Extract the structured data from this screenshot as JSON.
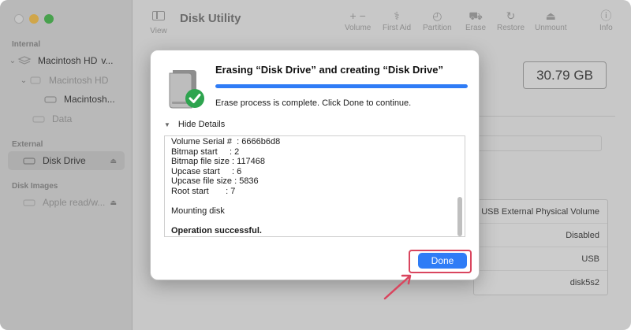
{
  "app": {
    "title": "Disk Utility"
  },
  "toolbar": {
    "view_label": "View",
    "items": [
      {
        "label": "Volume",
        "glyph": "+ −"
      },
      {
        "label": "First Aid",
        "glyph": "⚕"
      },
      {
        "label": "Partition",
        "glyph": "◴"
      },
      {
        "label": "Erase",
        "glyph": "⛟"
      },
      {
        "label": "Restore",
        "glyph": "↻"
      },
      {
        "label": "Unmount",
        "glyph": "⏏"
      },
      {
        "label": "Info",
        "glyph": "ⓘ"
      }
    ]
  },
  "sidebar": {
    "sections": {
      "internal": "Internal",
      "external": "External",
      "disk_images": "Disk Images"
    },
    "items": {
      "macintosh_hd_1": "Macintosh HD",
      "macintosh_hd_1_suffix": "v...",
      "macintosh_hd_2": "Macintosh HD",
      "macintosh_hd_3": "Macintosh...",
      "data": "Data",
      "disk_drive": "Disk Drive",
      "apple_read": "Apple read/w..."
    }
  },
  "background": {
    "capacity": "30.79 GB",
    "info_rows": [
      "USB External Physical Volume",
      "Disabled",
      "USB",
      "disk5s2"
    ]
  },
  "dialog": {
    "title": "Erasing “Disk Drive” and creating “Disk Drive”",
    "progress": 1.0,
    "status": "Erase process is complete. Click Done to continue.",
    "details_label": "Hide Details",
    "log_lines": [
      "Volume Serial #  : 6666b6d8",
      "Bitmap start     : 2",
      "Bitmap file size : 117468",
      "Upcase start     : 6",
      "Upcase file size : 5836",
      "Root start       : 7",
      "",
      "Mounting disk",
      "",
      "Operation successful."
    ],
    "done_label": "Done"
  },
  "colors": {
    "accent": "#2f7cf6",
    "highlight": "#d9455e",
    "check": "#2ea44f"
  }
}
